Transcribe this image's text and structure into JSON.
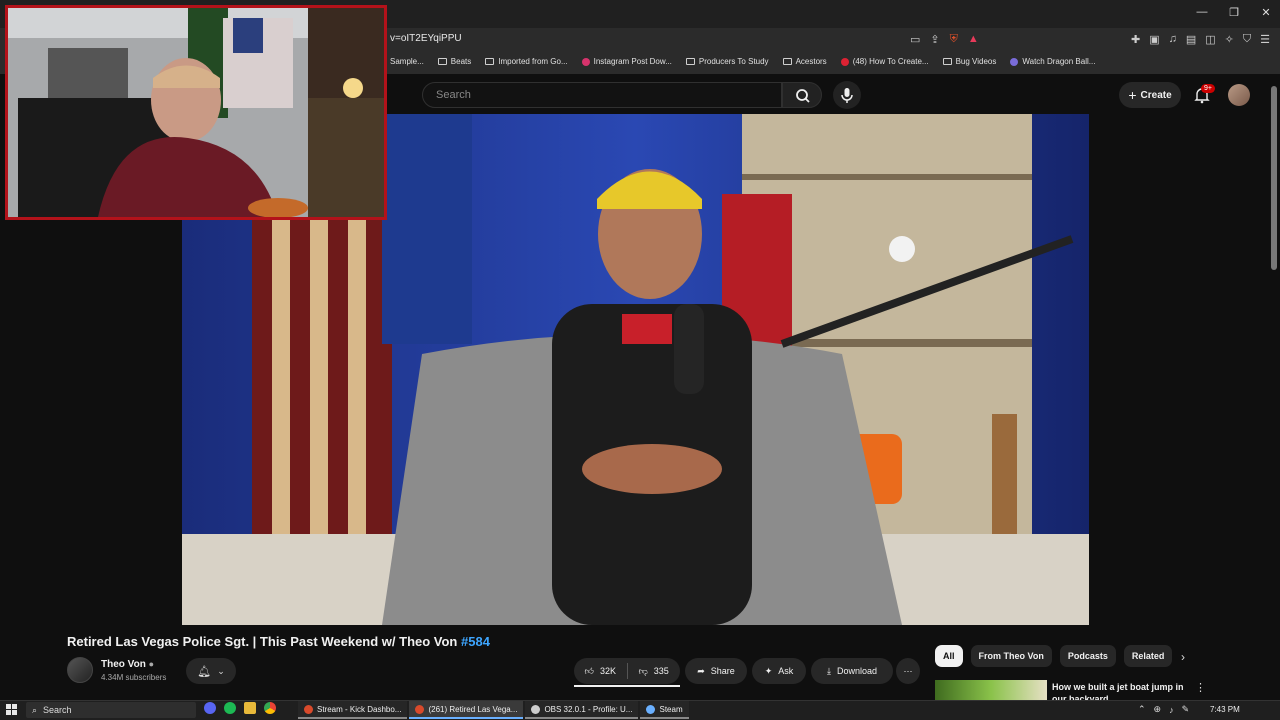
{
  "browser": {
    "url_fragment": "v=oIT2EYqiPPU",
    "bookmarks": [
      {
        "label": "Sample...",
        "icon": "folder-icon"
      },
      {
        "label": "Beats",
        "icon": "folder-icon"
      },
      {
        "label": "Imported from Go...",
        "icon": "folder-icon"
      },
      {
        "label": "Instagram Post Dow...",
        "icon": "instagram-icon"
      },
      {
        "label": "Producers To Study",
        "icon": "folder-icon"
      },
      {
        "label": "Acestors",
        "icon": "folder-icon"
      },
      {
        "label": "(48) How To Create...",
        "icon": "youtube-icon"
      },
      {
        "label": "Bug Videos",
        "icon": "folder-icon"
      },
      {
        "label": "Watch Dragon Ball...",
        "icon": "site-icon"
      }
    ]
  },
  "youtube": {
    "search_placeholder": "Search",
    "create_label": "Create",
    "notif_count": "9+"
  },
  "video": {
    "title_main": "Retired Las Vegas Police Sgt. | This Past Weekend w/ Theo Von",
    "title_tag": "#584",
    "channel_name": "Theo Von",
    "subscribers": "4.34M subscribers",
    "likes": "32K",
    "dislikes": "335",
    "share_label": "Share",
    "ask_label": "Ask",
    "download_label": "Download"
  },
  "chips": [
    "All",
    "From Theo Von",
    "Podcasts",
    "Related"
  ],
  "recommendation": {
    "title": "How we built a jet boat jump in our backyard"
  },
  "taskbar": {
    "search_label": "Search",
    "windows": [
      {
        "label": "Stream - Kick Dashbo...",
        "color": "#d94a2b"
      },
      {
        "label": "(261) Retired Las Vega...",
        "color": "#d94a2b"
      },
      {
        "label": "OBS 32.0.1 - Profile: U...",
        "color": "#cccccc"
      },
      {
        "label": "Steam",
        "color": "#6ab0ff"
      }
    ],
    "clock": "7:43 PM"
  },
  "colors": {
    "accent_link": "#3ea6ff",
    "webcam_border": "#b3121a",
    "notif_badge": "#cc0000"
  }
}
